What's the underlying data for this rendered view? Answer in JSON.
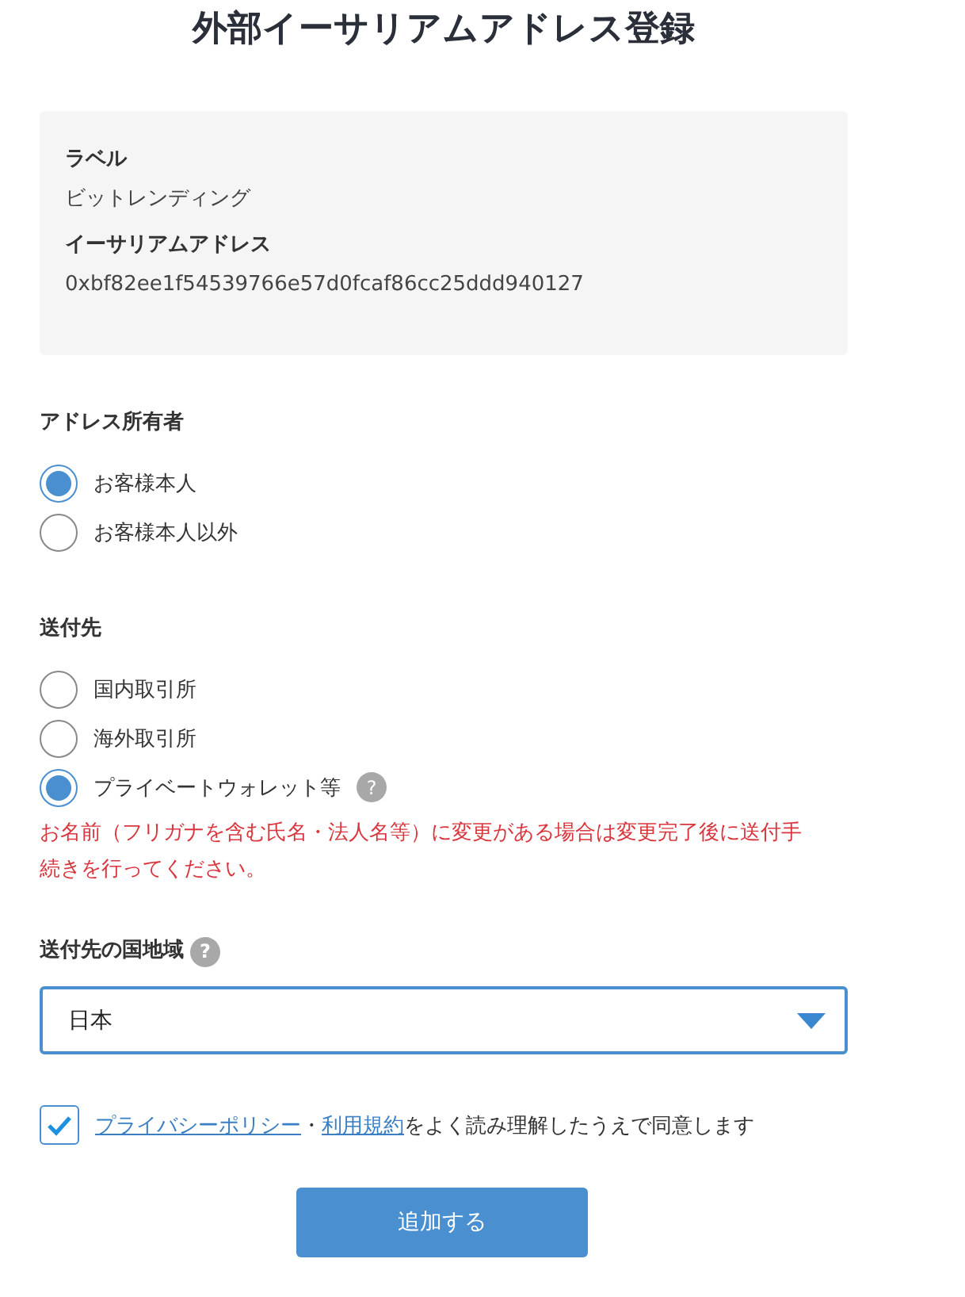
{
  "title": "外部イーサリアムアドレス登録",
  "info": [
    {
      "label": "ラベル",
      "value": "ビットレンディング"
    },
    {
      "label": "イーサリアムアドレス",
      "value": "0xbf82ee1f54539766e57d0fcaf86cc25ddd940127"
    }
  ],
  "owner": {
    "label": "アドレス所有者",
    "options": [
      {
        "label": "お客様本人",
        "selected": true
      },
      {
        "label": "お客様本人以外",
        "selected": false
      }
    ]
  },
  "destination": {
    "label": "送付先",
    "options": [
      {
        "label": "国内取引所",
        "selected": false
      },
      {
        "label": "海外取引所",
        "selected": false
      },
      {
        "label": "プライベートウォレット等",
        "selected": true,
        "help": "?"
      }
    ],
    "warning": "お名前（フリガナを含む氏名・法人名等）に変更がある場合は変更完了後に送付手続きを行ってください。"
  },
  "country": {
    "label": "送付先の国地域",
    "help": "?",
    "value": "日本"
  },
  "agreement": {
    "checked": true,
    "links": [
      "プライバシーポリシー",
      "利用規約"
    ],
    "separator": "・",
    "text": "をよく読み理解したうえで同意します"
  },
  "submit": "追加する"
}
